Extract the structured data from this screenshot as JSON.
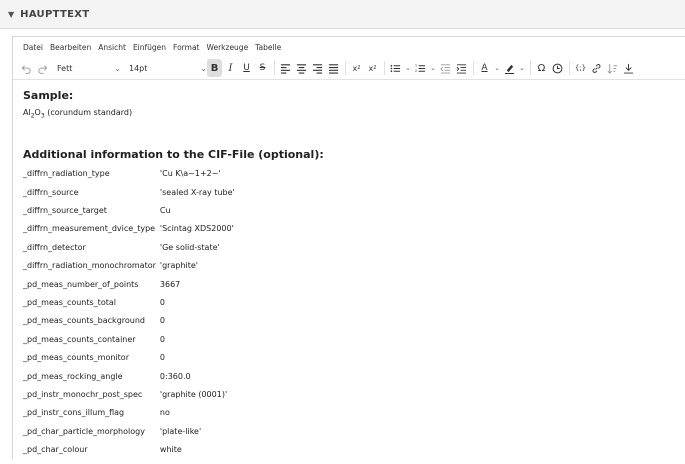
{
  "section": {
    "title": "HAUPTTEXT"
  },
  "menu": [
    "Datei",
    "Bearbeiten",
    "Ansicht",
    "Einfügen",
    "Format",
    "Werkzeuge",
    "Tabelle"
  ],
  "toolbar": {
    "block_format": "Fett",
    "font_size": "14pt"
  },
  "content": {
    "sample_heading": "Sample:",
    "sample_el1": "Al",
    "sample_sub1": "2",
    "sample_el2": "O",
    "sample_sub2": "3",
    "sample_text": " (corundum standard)",
    "additional_heading": "Additional information to the CIF-File (optional):",
    "rows": [
      {
        "key": "_diffrn_radiation_type",
        "value": "'Cu K\\a~1+2~'"
      },
      {
        "key": "_diffrn_source",
        "value": "'sealed X-ray tube'"
      },
      {
        "key": "_diffrn_source_target",
        "value": "Cu"
      },
      {
        "key": "_diffrn_measurement_dvice_type",
        "value": "'Scintag XDS2000'"
      },
      {
        "key": "_diffrn_detector",
        "value": "'Ge solid-state'"
      },
      {
        "key": "_diffrn_radiation_monochromator",
        "value": "'graphite'"
      },
      {
        "key": "_pd_meas_number_of_points",
        "value": "3667"
      },
      {
        "key": "_pd_meas_counts_total",
        "value": "0"
      },
      {
        "key": "_pd_meas_counts_background",
        "value": "0"
      },
      {
        "key": "_pd_meas_counts_container",
        "value": "0"
      },
      {
        "key": "_pd_meas_counts_monitor",
        "value": "0"
      },
      {
        "key": "_pd_meas_rocking_angle",
        "value": "0:360.0"
      },
      {
        "key": "_pd_instr_monochr_post_spec",
        "value": "'graphite (0001)'"
      },
      {
        "key": "_pd_instr_cons_illum_flag",
        "value": "no"
      },
      {
        "key": "_pd_char_particle_morphology",
        "value": "'plate-like'"
      },
      {
        "key": "_pd_char_colour",
        "value": "white"
      }
    ]
  }
}
